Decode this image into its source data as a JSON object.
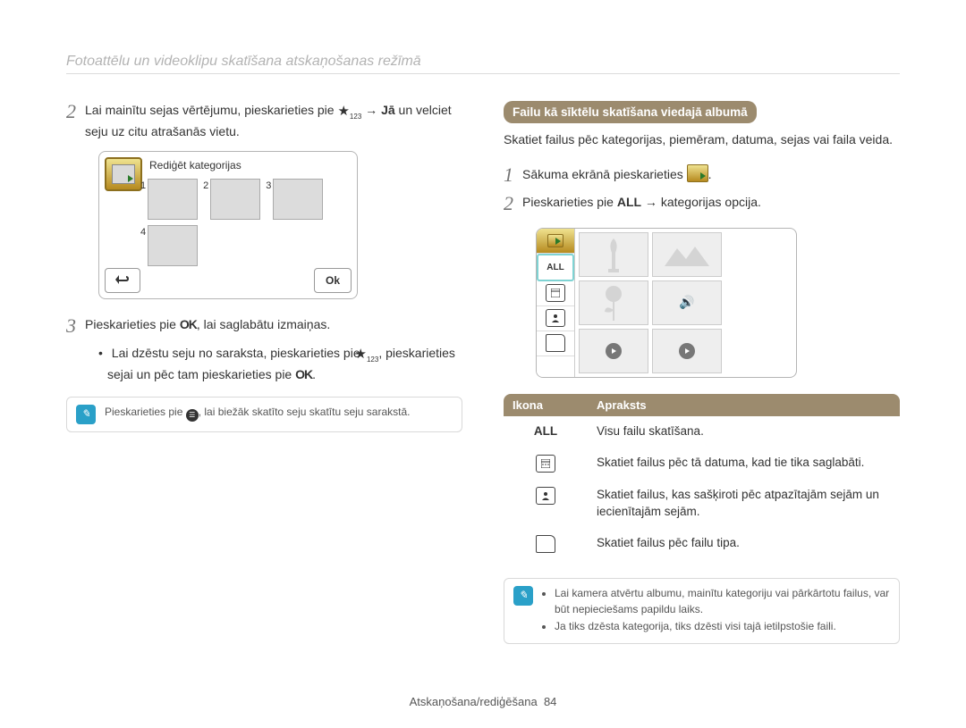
{
  "header": "Fotoattēlu un videoklipu skatīšana atskaņošanas režīmā",
  "left": {
    "step2_a": "Lai mainītu sejas vērtējumu, pieskarieties pie ",
    "step2_b": " → ",
    "step2_c": "Jā",
    "step2_d": " un velciet seju uz citu atrašanās vietu.",
    "screenshot_label": "Rediģēt kategorijas",
    "nums": [
      "1",
      "2",
      "3",
      "4"
    ],
    "ok": "Ok",
    "step3_a": "Pieskarieties pie ",
    "step3_b": ", lai saglabātu izmaiņas.",
    "bullet_a": "Lai dzēstu seju no saraksta, pieskarieties pie ",
    "bullet_b": ", pieskarieties sejai un pēc tam pieskarieties pie ",
    "bullet_c": ".",
    "note_a": "Pieskarieties pie ",
    "note_b": ", lai biežāk skatīto seju skatītu seju sarakstā."
  },
  "right": {
    "heading": "Failu kā sīktēlu skatīšana viedajā albumā",
    "intro": "Skatiet failus pēc kategorijas, piemēram, datuma, sejas vai faila veida.",
    "step1_a": "Sākuma ekrānā pieskarieties ",
    "step1_b": ".",
    "step2_a": "Pieskarieties pie ",
    "step2_b": "ALL",
    "step2_c": " → kategorijas opcija.",
    "sidebar_all": "ALL",
    "table": {
      "h1": "Ikona",
      "h2": "Apraksts",
      "rows": [
        {
          "icon": "ALL",
          "text": "Visu failu skatīšana."
        },
        {
          "icon": "calendar",
          "text": "Skatiet failus pēc tā datuma, kad tie tika saglabāti."
        },
        {
          "icon": "person",
          "text": "Skatiet failus, kas sašķiroti pēc atpazītajām sejām un iecienītajām sejām."
        },
        {
          "icon": "folder",
          "text": "Skatiet failus pēc failu tipa."
        }
      ]
    },
    "note_items": [
      "Lai kamera atvērtu albumu, mainītu kategoriju vai pārkārtotu failus, var būt nepieciešams papildu laiks.",
      "Ja tiks dzēsta kategorija, tiks dzēsti visi tajā ietilpstošie faili."
    ]
  },
  "footer_a": "Atskaņošana/rediģēšana",
  "footer_b": "84",
  "icons": {
    "pencil": "✎"
  }
}
